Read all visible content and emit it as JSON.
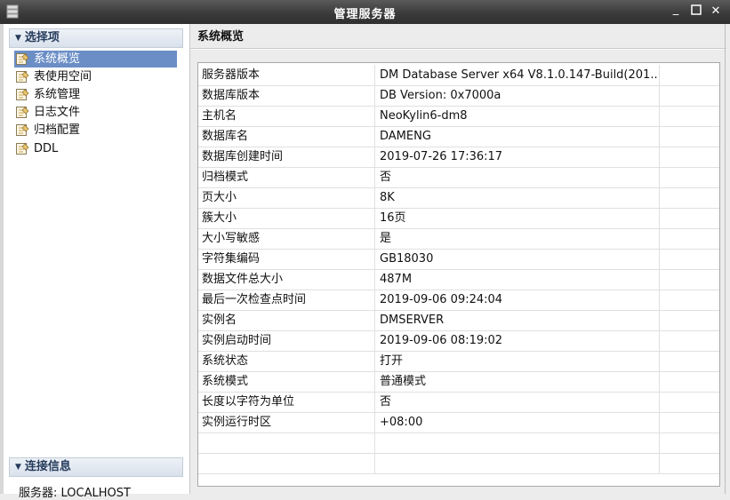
{
  "window": {
    "title": "管理服务器"
  },
  "sidebar": {
    "section_options": "选择项",
    "items": [
      {
        "label": "系统概览",
        "icon": "page-icon",
        "selected": true
      },
      {
        "label": "表使用空间",
        "icon": "page-icon",
        "selected": false
      },
      {
        "label": "系统管理",
        "icon": "page-icon",
        "selected": false
      },
      {
        "label": "日志文件",
        "icon": "page-icon",
        "selected": false
      },
      {
        "label": "归档配置",
        "icon": "page-icon",
        "selected": false
      },
      {
        "label": "DDL",
        "icon": "page-icon",
        "selected": false
      }
    ],
    "section_connection": "连接信息",
    "connection_server": "服务器: LOCALHOST"
  },
  "main": {
    "title": "系统概览",
    "rows": [
      {
        "key": "服务器版本",
        "value": "DM Database Server x64 V8.1.0.147-Build(201..."
      },
      {
        "key": "数据库版本",
        "value": "DB Version: 0x7000a"
      },
      {
        "key": "主机名",
        "value": "NeoKylin6-dm8"
      },
      {
        "key": "数据库名",
        "value": "DAMENG"
      },
      {
        "key": "数据库创建时间",
        "value": "2019-07-26 17:36:17"
      },
      {
        "key": "归档模式",
        "value": "否"
      },
      {
        "key": "页大小",
        "value": "8K"
      },
      {
        "key": "簇大小",
        "value": "16页"
      },
      {
        "key": "大小写敏感",
        "value": "是"
      },
      {
        "key": "字符集编码",
        "value": "GB18030"
      },
      {
        "key": "数据文件总大小",
        "value": "487M"
      },
      {
        "key": "最后一次检查点时间",
        "value": "2019-09-06 09:24:04"
      },
      {
        "key": "实例名",
        "value": "DMSERVER"
      },
      {
        "key": "实例启动时间",
        "value": "2019-09-06 08:19:02"
      },
      {
        "key": "系统状态",
        "value": "打开"
      },
      {
        "key": "系统模式",
        "value": "普通模式"
      },
      {
        "key": "长度以字符为单位",
        "value": "否"
      },
      {
        "key": "实例运行时区",
        "value": "+08:00"
      },
      {
        "key": "",
        "value": ""
      },
      {
        "key": "",
        "value": ""
      }
    ]
  },
  "colors": {
    "selection": "#6b8ec6",
    "titlebar": "#3b3b3b"
  }
}
